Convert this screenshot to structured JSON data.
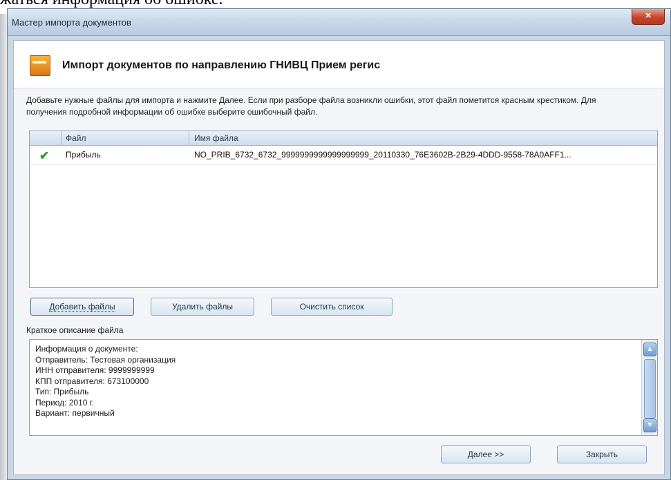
{
  "document_text": "жаться информация об ошибке.",
  "window": {
    "title": "Мастер импорта документов",
    "close_label": "×"
  },
  "header": {
    "title": "Импорт документов по направлению ГНИВЦ Прием регис"
  },
  "instructions": "Добавьте нужные файлы для импорта и нажмите Далее. Если при разборе файла возникли ошибки, этот файл пометится красным крестиком. Для получения подробной информации об ошибке выберите ошибочный файл.",
  "file_table": {
    "columns": [
      "Файл",
      "Имя файла"
    ],
    "rows": [
      {
        "status_icon": "check-icon",
        "file": "Прибыль",
        "name": "NO_PRIB_6732_6732_9999999999999999999_20110330_76E3602B-2B29-4DDD-9558-78A0AFF1..."
      }
    ]
  },
  "buttons": {
    "add": "Добавить файлы",
    "remove": "Удалить файлы",
    "clear": "Очистить список",
    "next": "Далее >>",
    "close": "Закрыть"
  },
  "description": {
    "label": "Краткое описание файла",
    "lines": [
      "Информация о документе:",
      "Отправитель: Тестовая организация",
      "ИНН отправителя: 9999999999",
      "КПП отправителя: 673100000",
      "Тип: Прибыль",
      "Период: 2010 г.",
      "Вариант: первичный"
    ]
  },
  "colors": {
    "check": "#2f9a2a",
    "close_button": "#c9442a",
    "accent": "#6f9ccc"
  }
}
